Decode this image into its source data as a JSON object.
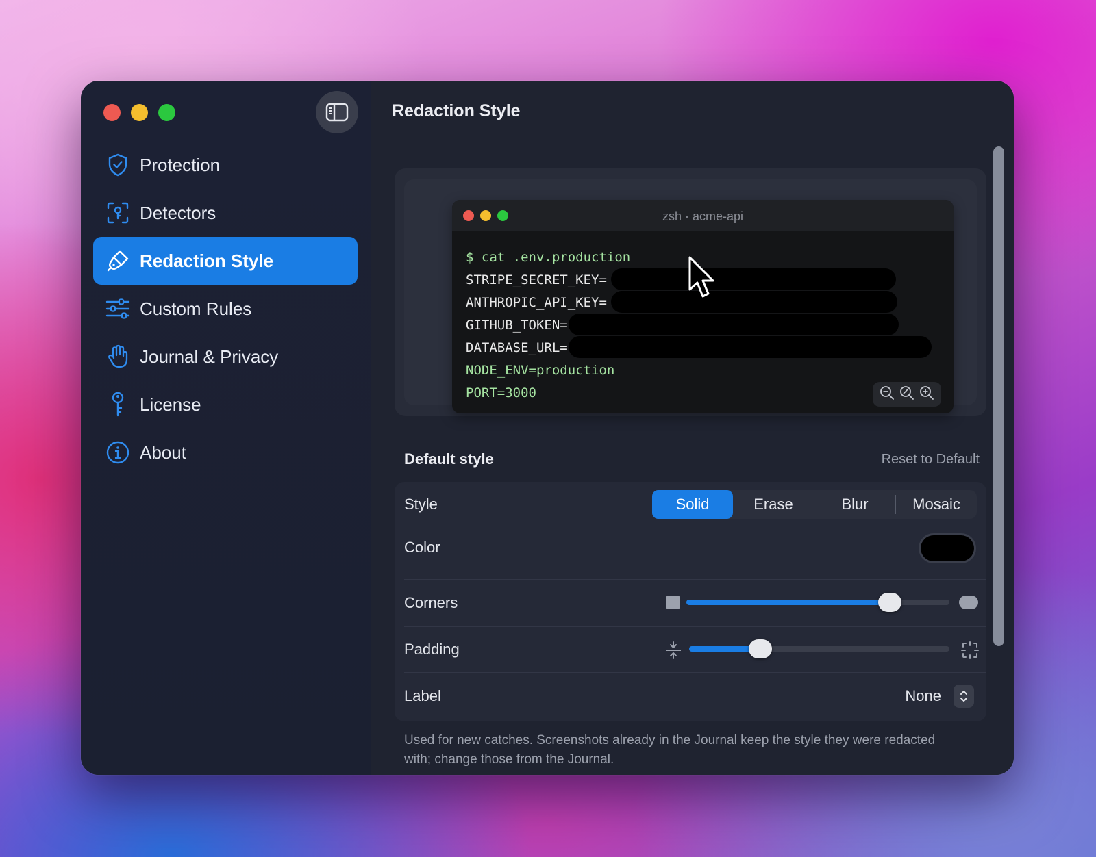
{
  "colors": {
    "accent": "#1a7de4",
    "window_bg": "#1d2131",
    "sidebar_bg": "#1c2134",
    "terminal_bg": "#141517",
    "terminal_green": "#a5e3a1",
    "redaction_color": "#000000"
  },
  "sidebar": {
    "toggle_icon": "sidebar-toggle-icon",
    "items": [
      {
        "label": "Protection",
        "icon": "shield-check-icon",
        "active": false
      },
      {
        "label": "Detectors",
        "icon": "scan-key-icon",
        "active": false
      },
      {
        "label": "Redaction Style",
        "icon": "paintbrush-icon",
        "active": true
      },
      {
        "label": "Custom Rules",
        "icon": "sliders-icon",
        "active": false
      },
      {
        "label": "Journal & Privacy",
        "icon": "hand-icon",
        "active": false
      },
      {
        "label": "License",
        "icon": "key-icon",
        "active": false
      },
      {
        "label": "About",
        "icon": "info-icon",
        "active": false
      }
    ]
  },
  "main": {
    "title": "Redaction Style",
    "preview": {
      "terminal_title": "zsh · acme-api",
      "lines": [
        "$ cat .env.production",
        "STRIPE_SECRET_KEY=",
        "ANTHROPIC_API_KEY=",
        "GITHUB_TOKEN=",
        "DATABASE_URL=",
        "NODE_ENV=production",
        "PORT=3000"
      ],
      "zoom_icons": [
        "zoom-out-icon",
        "zoom-reset-icon",
        "zoom-in-icon"
      ]
    },
    "section": {
      "title": "Default style",
      "reset_label": "Reset to Default"
    },
    "settings": {
      "style_label": "Style",
      "style_options": [
        "Solid",
        "Erase",
        "Blur",
        "Mosaic"
      ],
      "style_selected": "Solid",
      "color_label": "Color",
      "color_value": "#000000",
      "corners_label": "Corners",
      "corners_value": 0.8,
      "padding_label": "Padding",
      "padding_value": 0.25,
      "label_label": "Label",
      "label_value": "None"
    },
    "footnote": "Used for new catches. Screenshots already in the Journal keep the style they were redacted with; change those from the Journal."
  }
}
